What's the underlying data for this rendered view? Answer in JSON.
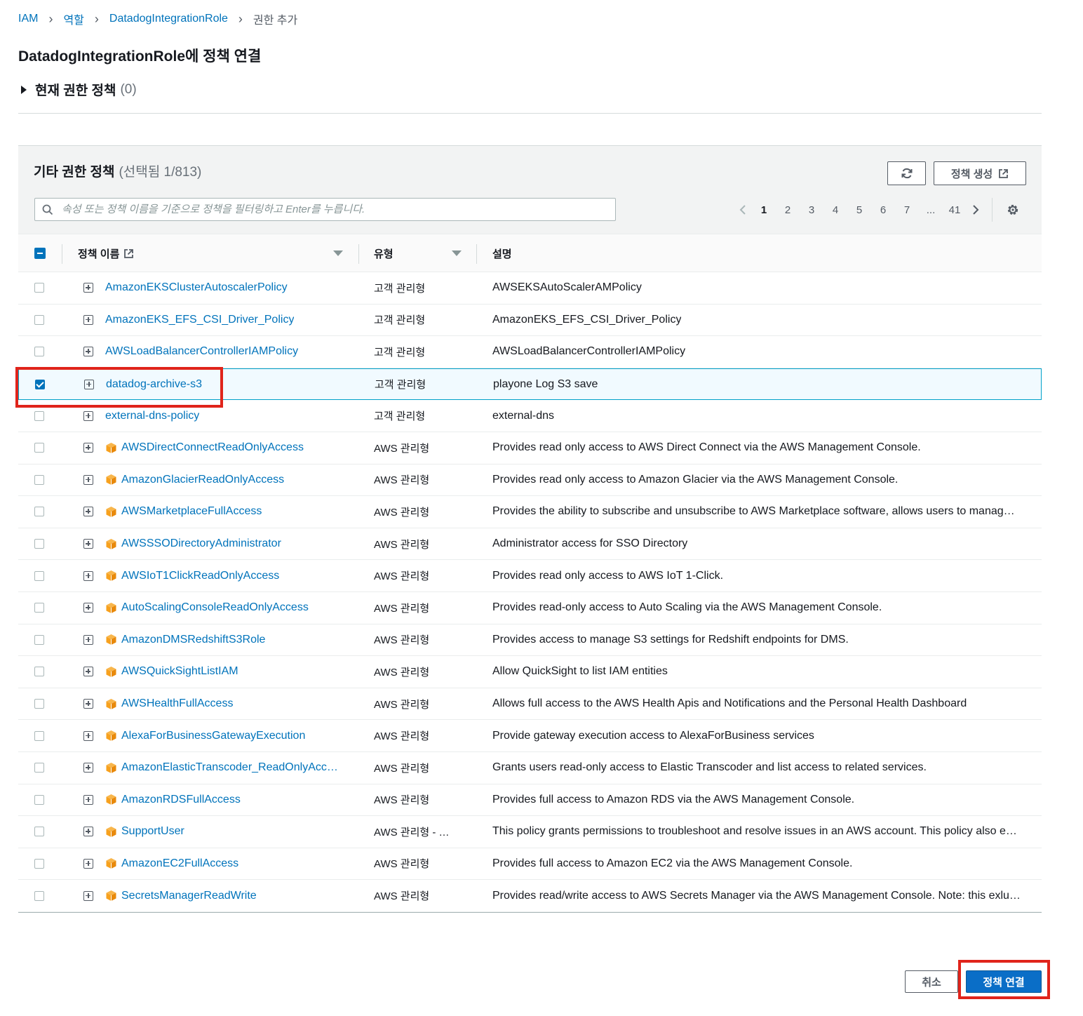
{
  "breadcrumb": [
    "IAM",
    "역할",
    "DatadogIntegrationRole",
    "권한 추가"
  ],
  "page_title": "DatadogIntegrationRole에 정책 연결",
  "current_permissions": {
    "label": "현재 권한 정책",
    "count": "(0)"
  },
  "panel": {
    "title": "기타 권한 정책",
    "selected": "(선택됨 1/813)",
    "create_button": "정책 생성",
    "search_placeholder": "속성 또는 정책 이름을 기준으로 정책을 필터링하고 Enter를 누릅니다.",
    "pages": [
      "1",
      "2",
      "3",
      "4",
      "5",
      "6",
      "7",
      "...",
      "41"
    ],
    "active_page": "1"
  },
  "table": {
    "col_name": "정책 이름",
    "col_type": "유형",
    "col_desc": "설명",
    "rows": [
      {
        "name": "AmazonEKSClusterAutoscalerPolicy",
        "type": "고객 관리형",
        "desc": "AWSEKSAutoScalerAMPolicy",
        "aws": false,
        "checked": false
      },
      {
        "name": "AmazonEKS_EFS_CSI_Driver_Policy",
        "type": "고객 관리형",
        "desc": "AmazonEKS_EFS_CSI_Driver_Policy",
        "aws": false,
        "checked": false
      },
      {
        "name": "AWSLoadBalancerControllerIAMPolicy",
        "type": "고객 관리형",
        "desc": "AWSLoadBalancerControllerIAMPolicy",
        "aws": false,
        "checked": false
      },
      {
        "name": "datadog-archive-s3",
        "type": "고객 관리형",
        "desc": "playone Log S3 save",
        "aws": false,
        "checked": true
      },
      {
        "name": "external-dns-policy",
        "type": "고객 관리형",
        "desc": "external-dns",
        "aws": false,
        "checked": false
      },
      {
        "name": "AWSDirectConnectReadOnlyAccess",
        "type": "AWS 관리형",
        "desc": "Provides read only access to AWS Direct Connect via the AWS Management Console.",
        "aws": true,
        "checked": false
      },
      {
        "name": "AmazonGlacierReadOnlyAccess",
        "type": "AWS 관리형",
        "desc": "Provides read only access to Amazon Glacier via the AWS Management Console.",
        "aws": true,
        "checked": false
      },
      {
        "name": "AWSMarketplaceFullAccess",
        "type": "AWS 관리형",
        "desc": "Provides the ability to subscribe and unsubscribe to AWS Marketplace software, allows users to manag…",
        "aws": true,
        "checked": false
      },
      {
        "name": "AWSSSODirectoryAdministrator",
        "type": "AWS 관리형",
        "desc": "Administrator access for SSO Directory",
        "aws": true,
        "checked": false
      },
      {
        "name": "AWSIoT1ClickReadOnlyAccess",
        "type": "AWS 관리형",
        "desc": "Provides read only access to AWS IoT 1-Click.",
        "aws": true,
        "checked": false
      },
      {
        "name": "AutoScalingConsoleReadOnlyAccess",
        "type": "AWS 관리형",
        "desc": "Provides read-only access to Auto Scaling via the AWS Management Console.",
        "aws": true,
        "checked": false
      },
      {
        "name": "AmazonDMSRedshiftS3Role",
        "type": "AWS 관리형",
        "desc": "Provides access to manage S3 settings for Redshift endpoints for DMS.",
        "aws": true,
        "checked": false
      },
      {
        "name": "AWSQuickSightListIAM",
        "type": "AWS 관리형",
        "desc": "Allow QuickSight to list IAM entities",
        "aws": true,
        "checked": false
      },
      {
        "name": "AWSHealthFullAccess",
        "type": "AWS 관리형",
        "desc": "Allows full access to the AWS Health Apis and Notifications and the Personal Health Dashboard",
        "aws": true,
        "checked": false
      },
      {
        "name": "AlexaForBusinessGatewayExecution",
        "type": "AWS 관리형",
        "desc": "Provide gateway execution access to AlexaForBusiness services",
        "aws": true,
        "checked": false
      },
      {
        "name": "AmazonElasticTranscoder_ReadOnlyAcc…",
        "type": "AWS 관리형",
        "desc": "Grants users read-only access to Elastic Transcoder and list access to related services.",
        "aws": true,
        "checked": false
      },
      {
        "name": "AmazonRDSFullAccess",
        "type": "AWS 관리형",
        "desc": "Provides full access to Amazon RDS via the AWS Management Console.",
        "aws": true,
        "checked": false
      },
      {
        "name": "SupportUser",
        "type": "AWS 관리형 - …",
        "desc": "This policy grants permissions to troubleshoot and resolve issues in an AWS account. This policy also e…",
        "aws": true,
        "checked": false
      },
      {
        "name": "AmazonEC2FullAccess",
        "type": "AWS 관리형",
        "desc": "Provides full access to Amazon EC2 via the AWS Management Console.",
        "aws": true,
        "checked": false
      },
      {
        "name": "SecretsManagerReadWrite",
        "type": "AWS 관리형",
        "desc": "Provides read/write access to AWS Secrets Manager via the AWS Management Console. Note: this exlu…",
        "aws": true,
        "checked": false
      }
    ]
  },
  "footer": {
    "cancel": "취소",
    "attach": "정책 연결"
  },
  "colors": {
    "link": "#0073bb",
    "primary": "#0a6ec7",
    "highlight": "#e0241b",
    "aws_icon": "#f7a11e"
  }
}
